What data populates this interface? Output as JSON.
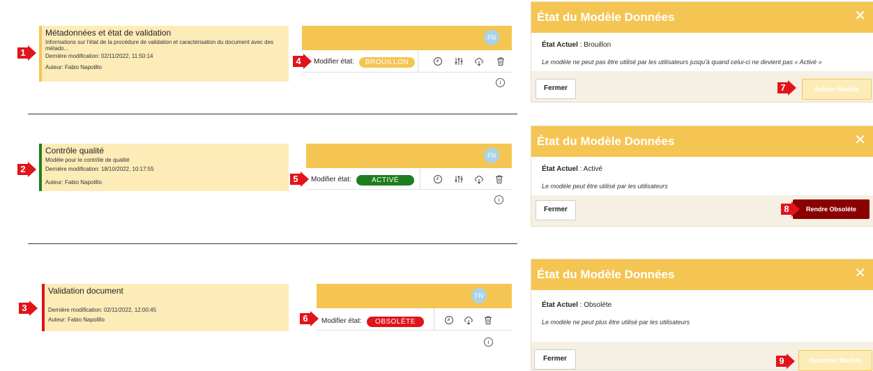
{
  "markers": [
    "1",
    "2",
    "3",
    "4",
    "5",
    "6",
    "7",
    "8",
    "9"
  ],
  "avatar_initials": "FN",
  "modify_state_label": "Modifier état:",
  "info_glyph": "i",
  "documents": [
    {
      "title": "Métadonnées et état de validation",
      "description": "Informations sur l'état de la procédure de validation et caractérisation du document avec des métado...",
      "last_modified": "Dernière modification: 02/11/2022, 11:50:14",
      "author": "Auteur: Fabio Napolillo",
      "state_label": "BROUILLON",
      "state_color": "#f5c553",
      "bar_color": "#f5c553"
    },
    {
      "title": "Contrôle qualité",
      "description": "Modèle pour le contrôle de qualité",
      "last_modified": "Dernière modification: 18/10/2022, 10:17:55",
      "author": "Auteur: Fabio Napolillo",
      "state_label": "ACTIVÉ",
      "state_color": "#1e7e1e",
      "bar_color": "#1e7e1e"
    },
    {
      "title": "Validation document",
      "description": "",
      "last_modified": "Dernière modification: 02/11/2022, 12:00:45",
      "author": "Auteur: Fabio Napolillo",
      "state_label": "OBSOLÈTE",
      "state_color": "#e0141a",
      "bar_color": "#e0141a"
    }
  ],
  "modals": [
    {
      "title": "État du Modèle Données",
      "current_label": "État Actuel",
      "current_value": ": Brouillon",
      "message": "Le modèle ne peut pas être utilisé par les utilisateurs jusqu'à quand celui-ci ne devient pas « Activé »",
      "close_label": "Fermer",
      "action_label": "Activer Modèle",
      "action_color": "#f5c553"
    },
    {
      "title": "État du Modèle Données",
      "current_label": "État Actuel",
      "current_value": ": Activé",
      "message": "Le modèle peut être utilisé par les utilisateurs",
      "close_label": "Fermer",
      "action_label": "Rendre Obsolète",
      "action_color": "#8b0000"
    },
    {
      "title": "État du Modèle Données",
      "current_label": "État Actuel",
      "current_value": ": Obsolète",
      "message": "Le modèle ne peut plus être utilisé par les utilisateurs",
      "close_label": "Fermer",
      "action_label": "Réactiver Modèle",
      "action_color": "#fdecb8"
    }
  ]
}
